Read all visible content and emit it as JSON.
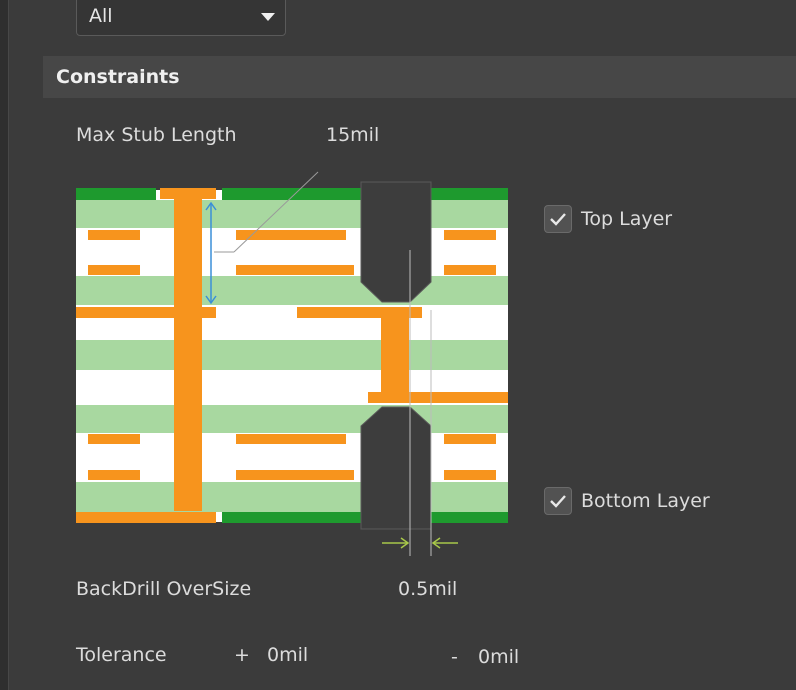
{
  "filter": {
    "selected": "All"
  },
  "constraints": {
    "title": "Constraints",
    "max_stub_length": {
      "label": "Max Stub Length",
      "value": "15mil"
    },
    "top_layer": {
      "label": "Top Layer",
      "checked": true
    },
    "bottom_layer": {
      "label": "Bottom Layer",
      "checked": true
    },
    "backdrill_oversize": {
      "label": "BackDrill OverSize",
      "value": "0.5mil"
    },
    "tolerance": {
      "label": "Tolerance",
      "plus_sign": "+",
      "plus_value": "0mil",
      "minus_sign": "-",
      "minus_value": "0mil"
    }
  },
  "colors": {
    "background": "#3b3b3b",
    "copper": "#f7941d",
    "dielectric": "#a8d8a0",
    "solder_mask": "#1e9a2e",
    "drill_hole": "#3d3d3d",
    "dimension_arrow": "#3a8fd8",
    "oversize_arrow": "#a8c84a"
  },
  "icons": {
    "dropdown": "chevron-down-icon",
    "checkbox": "check-icon"
  }
}
